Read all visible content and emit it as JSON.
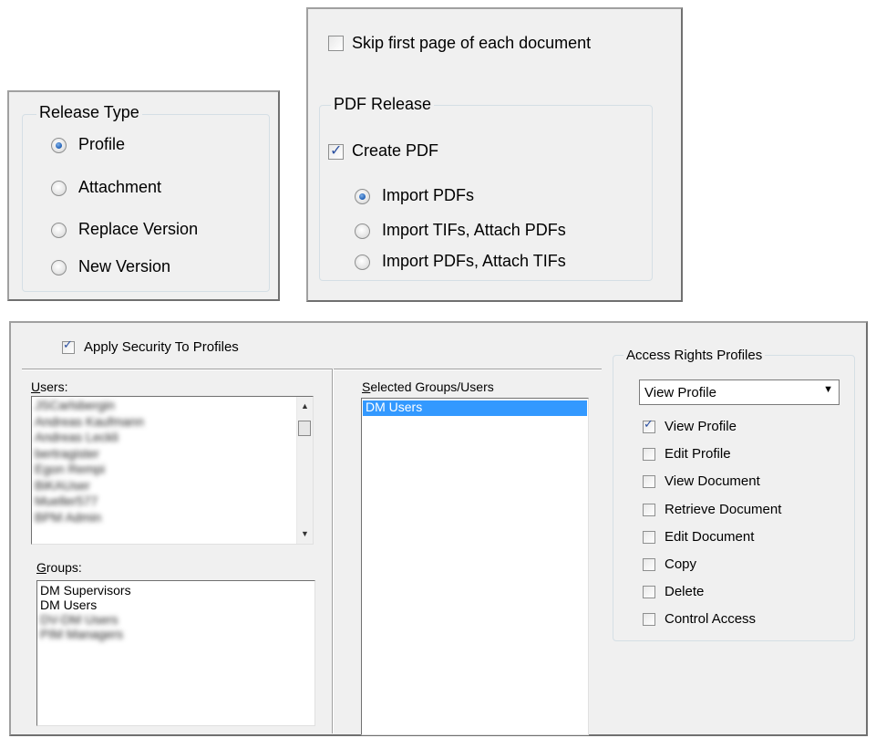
{
  "release_type": {
    "legend": "Release Type",
    "options": [
      {
        "label": "Profile",
        "selected": true
      },
      {
        "label": "Attachment",
        "selected": false
      },
      {
        "label": "Replace Version",
        "selected": false
      },
      {
        "label": "New Version",
        "selected": false
      }
    ]
  },
  "pdf_panel": {
    "skip_first_page_label": "Skip first page of each document",
    "skip_first_page_checked": false,
    "pdf_release_legend": "PDF Release",
    "create_pdf_label": "Create PDF",
    "create_pdf_checked": true,
    "options": [
      {
        "label": "Import PDFs",
        "selected": true
      },
      {
        "label": "Import TIFs, Attach PDFs",
        "selected": false
      },
      {
        "label": "Import PDFs, Attach TIFs",
        "selected": false
      }
    ]
  },
  "security": {
    "apply_security_label": "Apply Security To Profiles",
    "apply_security_checked": true,
    "users_label_u": "U",
    "users_label_rest": "sers:",
    "users": [
      "JSCarlsbergin",
      "Andreas Kaufmann",
      "Andreas Leckli",
      "bertragister",
      "Egon Rempi",
      "BiKAUser",
      "Mueller577",
      "BPM Admin"
    ],
    "groups_label_g": "G",
    "groups_label_rest": "roups:",
    "groups": [
      "DM Supervisors",
      "DM Users",
      "DV-DM Users",
      "PIM Managers"
    ],
    "selected_label_s": "S",
    "selected_label_rest": "elected Groups/Users",
    "selected": [
      "DM Users"
    ]
  },
  "access_rights": {
    "legend": "Access Rights Profiles",
    "dropdown_value": "View Profile",
    "permissions": [
      {
        "label": "View Profile",
        "checked": true
      },
      {
        "label": "Edit Profile",
        "checked": false
      },
      {
        "label": "View Document",
        "checked": false
      },
      {
        "label": "Retrieve Document",
        "checked": false
      },
      {
        "label": "Edit Document",
        "checked": false
      },
      {
        "label": "Copy",
        "checked": false
      },
      {
        "label": "Delete",
        "checked": false
      },
      {
        "label": "Control Access",
        "checked": false
      }
    ]
  }
}
